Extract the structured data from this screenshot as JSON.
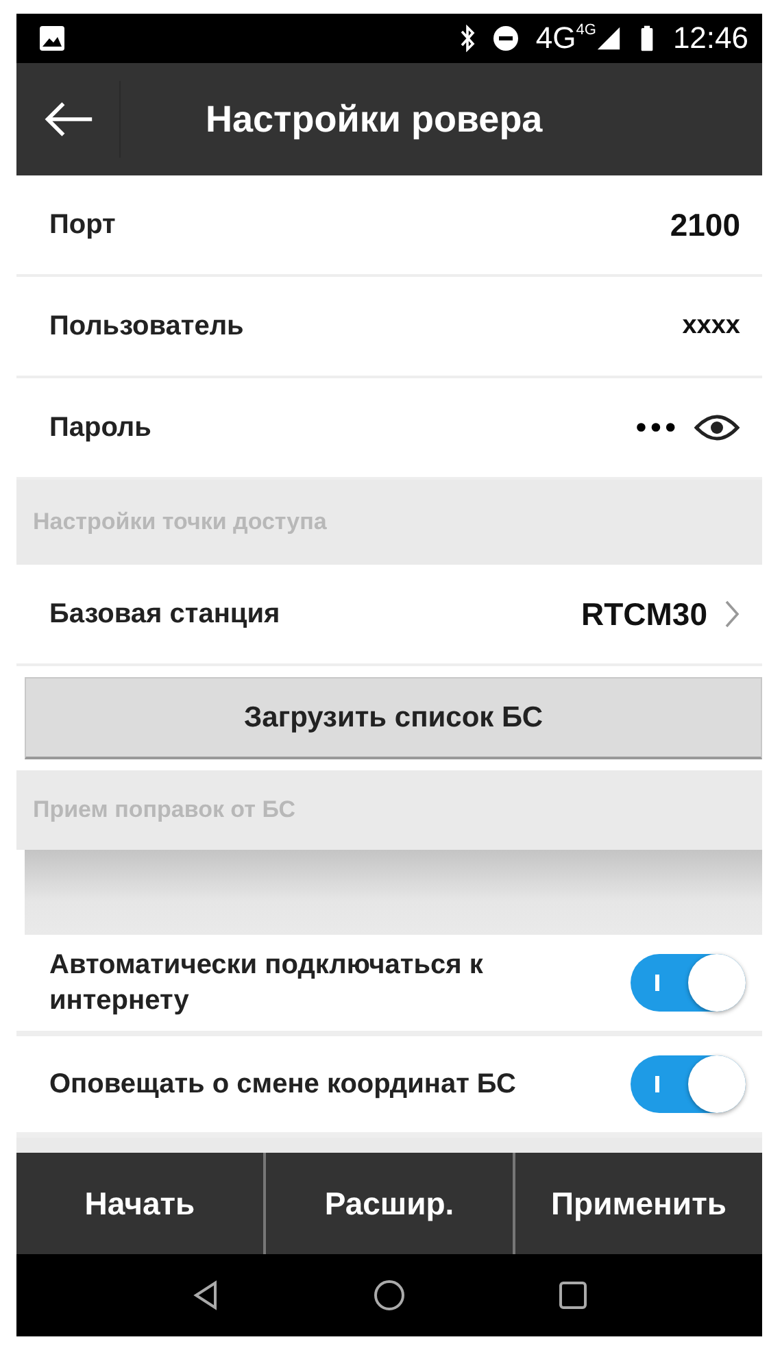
{
  "status_bar": {
    "network": "4G",
    "network_small": "4G",
    "time": "12:46"
  },
  "header": {
    "title": "Настройки ровера"
  },
  "fields": [
    {
      "kind": "value",
      "label": "Порт",
      "value": "2100"
    },
    {
      "kind": "value",
      "label": "Пользователь",
      "value": "xxxx"
    },
    {
      "kind": "password",
      "label": "Пароль",
      "value": "•••"
    }
  ],
  "access_point": {
    "heading": "Настройки точки доступа",
    "label": "Базовая станция",
    "value": "RTCM30",
    "load_button": "Загрузить список БС"
  },
  "corrections": {
    "heading": "Прием поправок от БС"
  },
  "toggles": [
    {
      "label": "Автоматически подключаться к интернету",
      "on": true
    },
    {
      "label": "Оповещать о смене координат БС",
      "on": true
    }
  ],
  "bottom_buttons": [
    "Начать",
    "Расшир.",
    "Применить"
  ]
}
